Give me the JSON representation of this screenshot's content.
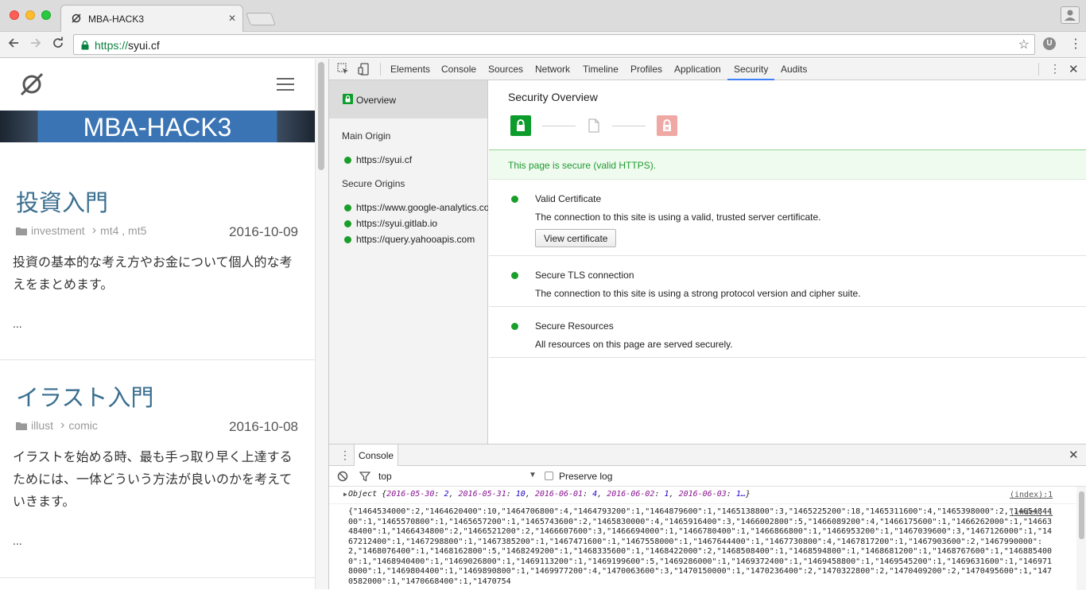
{
  "browser": {
    "tab_title": "MBA-HACK3",
    "tab_close": "✕",
    "url_scheme": "https://",
    "url_host": "syui.cf",
    "extension_label": "U",
    "traffic_colors": [
      "#fd5f57",
      "#febc2e",
      "#29c840"
    ]
  },
  "site": {
    "banner": "MBA-HACK3",
    "posts": [
      {
        "title": "投資入門",
        "category": "investment",
        "tags": "mt4 , mt5",
        "date": "2016-10-09",
        "body": "投資の基本的な考え方やお金について個人的な考えをまとめます。",
        "more": "..."
      },
      {
        "title": "イラスト入門",
        "category": "illust",
        "tags": "comic",
        "date": "2016-10-08",
        "body": "イラストを始める時、最も手っ取り早く上達するためには、一体どういう方法が良いのかを考えていきます。",
        "more": "..."
      }
    ]
  },
  "devtools": {
    "tabs": [
      "Elements",
      "Console",
      "Sources",
      "Network",
      "Timeline",
      "Profiles",
      "Application",
      "Security",
      "Audits"
    ],
    "active_tab": "Security",
    "sidebar": {
      "overview": "Overview",
      "main_origin_heading": "Main Origin",
      "main_origin": "https://syui.cf",
      "secure_origins_heading": "Secure Origins",
      "secure_origins": [
        "https://www.google-analytics.com",
        "https://syui.gitlab.io",
        "https://query.yahooapis.com"
      ]
    },
    "security": {
      "title": "Security Overview",
      "banner": "This page is secure (valid HTTPS).",
      "items": [
        {
          "heading": "Valid Certificate",
          "desc": "The connection to this site is using a valid, trusted server certificate.",
          "button": "View certificate"
        },
        {
          "heading": "Secure TLS connection",
          "desc": "The connection to this site is using a strong protocol version and cipher suite."
        },
        {
          "heading": "Secure Resources",
          "desc": "All resources on this page are served securely."
        }
      ],
      "colors": {
        "secure": "#0b9c2b",
        "insecure": "#f0a8a5"
      }
    },
    "console": {
      "tab_label": "Console",
      "context": "top",
      "preserve_log": "Preserve log",
      "source_link": "(index):1",
      "object_prefix": "Object {",
      "object_entries": [
        {
          "key": "2016-05-30",
          "value": "2"
        },
        {
          "key": "2016-05-31",
          "value": "10"
        },
        {
          "key": "2016-06-01",
          "value": "4"
        },
        {
          "key": "2016-06-02",
          "value": "1"
        },
        {
          "key": "2016-06-03",
          "value": "1…"
        }
      ],
      "object_suffix": "}",
      "json_text": "{\"1464534000\":2,\"1464620400\":10,\"1464706800\":4,\"1464793200\":1,\"1464879600\":1,\"1465138800\":3,\"1465225200\":18,\"1465311600\":4,\"1465398000\":2,\"1465484400\":1,\"1465570800\":1,\"1465657200\":1,\"1465743600\":2,\"1465830000\":4,\"1465916400\":3,\"1466002800\":5,\"1466089200\":4,\"1466175600\":1,\"1466262000\":1,\"1466348400\":1,\"1466434800\":2,\"1466521200\":2,\"1466607600\":3,\"1466694000\":1,\"1466780400\":1,\"1466866800\":1,\"1466953200\":1,\"1467039600\":3,\"1467126000\":1,\"1467212400\":1,\"1467298800\":1,\"1467385200\":1,\"1467471600\":1,\"1467558000\":1,\"1467644400\":1,\"1467730800\":4,\"1467817200\":1,\"1467903600\":2,\"1467990000\":2,\"1468076400\":1,\"1468162800\":5,\"1468249200\":1,\"1468335600\":1,\"1468422000\":2,\"1468508400\":1,\"1468594800\":1,\"1468681200\":1,\"1468767600\":1,\"1468854000\":1,\"1468940400\":1,\"1469026800\":1,\"1469113200\":1,\"1469199600\":5,\"1469286000\":1,\"1469372400\":1,\"1469458800\":1,\"1469545200\":1,\"1469631600\":1,\"1469718000\":1,\"1469804400\":1,\"1469890800\":1,\"1469977200\":4,\"1470063600\":3,\"1470150000\":1,\"1470236400\":2,\"1470322800\":2,\"1470409200\":2,\"1470495600\":1,\"1470582000\":1,\"1470668400\":1,\"1470754"
    }
  }
}
